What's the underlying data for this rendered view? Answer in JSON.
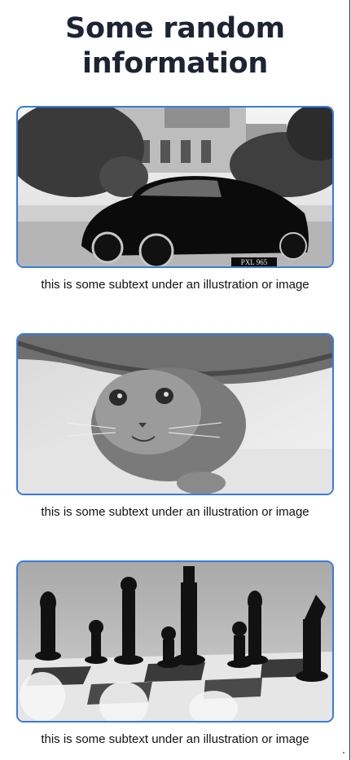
{
  "page": {
    "title": "Some random information"
  },
  "cards": [
    {
      "image_subject": "vintage black car in front of a manor",
      "plate_text": "PXL 965",
      "caption": "this is some subtext under an illustration or image"
    },
    {
      "image_subject": "cat peeking from under a rug",
      "caption": "this is some subtext under an illustration or image"
    },
    {
      "image_subject": "chess pieces on a board",
      "caption": "this is some subtext under an illustration or image"
    }
  ],
  "colors": {
    "title": "#1d2433",
    "card_border": "#3b7bdc"
  }
}
